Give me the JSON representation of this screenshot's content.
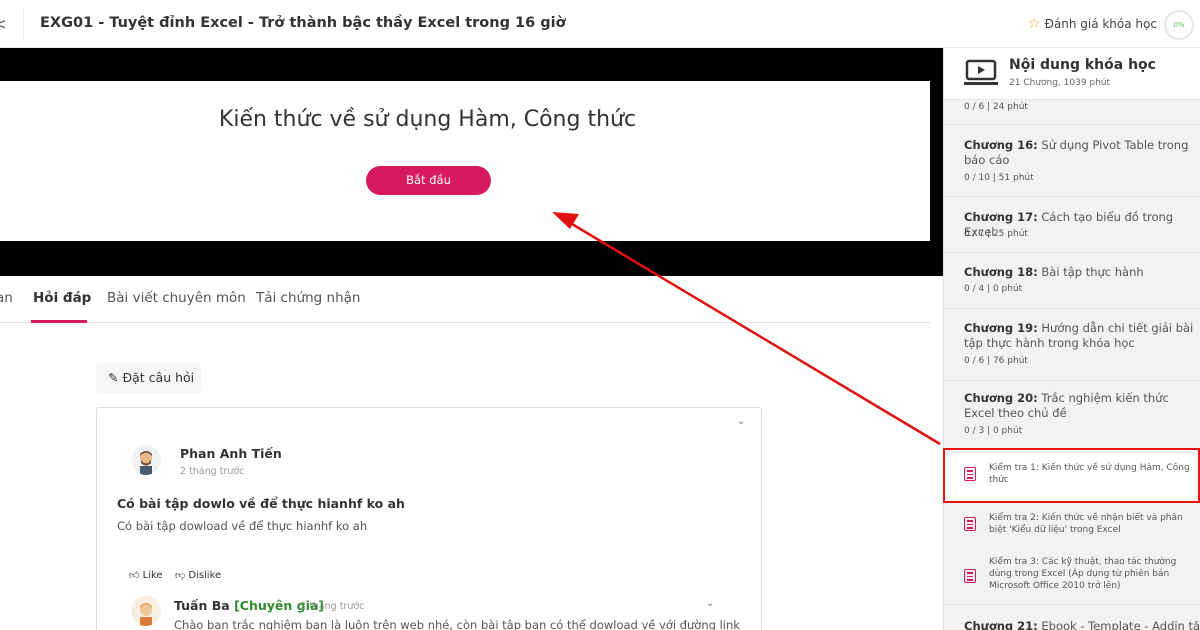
{
  "topbar": {
    "back_icon": "<",
    "course_title": "EXG01 - Tuyệt đỉnh Excel - Trở thành bậc thầy Excel trong 16 giờ",
    "rate_label": "Đánh giá khóa học",
    "progress": "0%"
  },
  "video": {
    "heading": "Kiến thức về sử dụng Hàm, Công thức",
    "start_button": "Bắt đầu"
  },
  "tabs": [
    {
      "label": "an"
    },
    {
      "label": "Hỏi đáp",
      "active": true
    },
    {
      "label": "Bài viết chuyên môn"
    },
    {
      "label": "Tải chứng nhận"
    }
  ],
  "qa": {
    "ask_button": "Đặt câu hỏi",
    "question": {
      "author": "Phan Anh Tiến",
      "time": "2 tháng trước",
      "title": "Có bài tập dowlo về để thực hianhf ko ah",
      "body": "Có bài tập dowload về để thực hianhf ko ah",
      "like": "Like",
      "dislike": "Dislike"
    },
    "reply": {
      "author": "Tuấn Ba",
      "badge": "[Chuyên gia]",
      "time": "2 tháng trước",
      "body": "Chào bạn trắc nghiệm bạn là luôn trên web nhé, còn bài tập bạn có thể dowload về với đường link"
    }
  },
  "sidebar": {
    "title": "Nội dung khóa học",
    "subtitle": "21 Chương, 1039 phút",
    "top_meta": "0 / 6  |  24 phút",
    "chapters": [
      {
        "prefix": "Chương 16:",
        "name": " Sử dụng Pivot Table trong báo cáo",
        "meta": "0 / 10  |  51 phút"
      },
      {
        "prefix": "Chương 17:",
        "name": " Cách tạo biểu đồ trong Excel",
        "meta": "0 / 7  |  25 phút"
      },
      {
        "prefix": "Chương 18:",
        "name": " Bài tập thực hành",
        "meta": "0 / 4  |  0 phút"
      },
      {
        "prefix": "Chương 19:",
        "name": " Hướng dẫn chi tiết giải bài tập thực hành trong khóa học",
        "meta": "0 / 6  |  76 phút"
      },
      {
        "prefix": "Chương 20:",
        "name": " Trắc nghiệm kiến thức Excel theo chủ đề",
        "meta": "0 / 3  |  0 phút"
      }
    ],
    "quizzes": [
      {
        "label": "Kiểm tra 1: Kiến thức về sử dụng Hàm, Công thức",
        "highlighted": true
      },
      {
        "label": "Kiểm tra 2: Kiến thức về nhận biết và phân biệt 'Kiểu dữ liệu' trong Excel"
      },
      {
        "label": "Kiểm tra 3: Các kỹ thuật, thao tác thường dùng trong Excel (Áp dụng từ phiên bản Microsoft Office 2010 trở lên)"
      }
    ],
    "last_chapter": {
      "prefix": "Chương 21:",
      "name": " Ebook - Template - Addin tặng"
    }
  },
  "colors": {
    "accent": "#d7195d",
    "annotation": "#e11111",
    "sidebar_bg": "#f2f2f2"
  }
}
